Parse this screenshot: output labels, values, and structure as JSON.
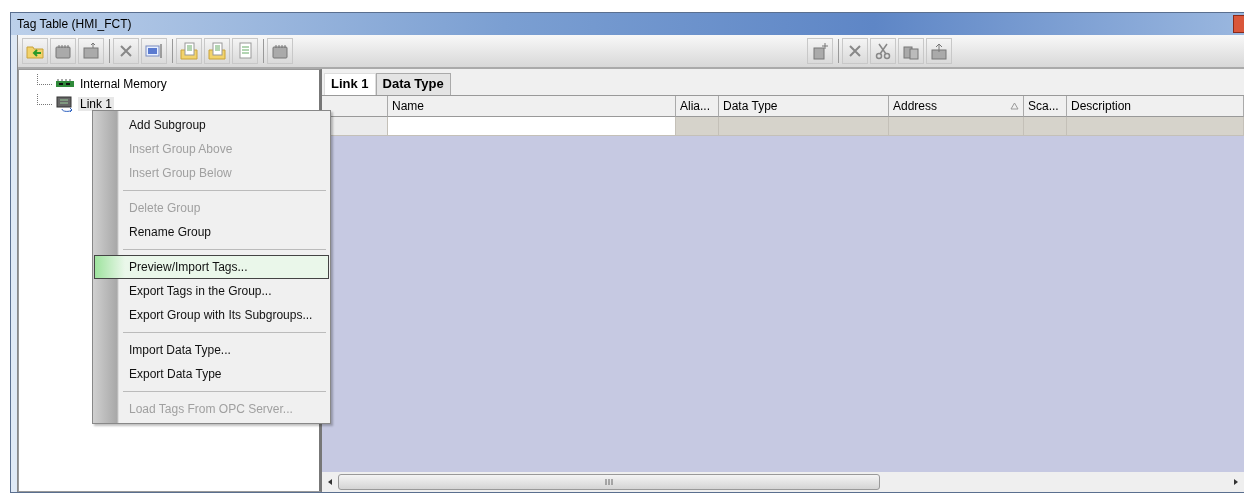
{
  "window": {
    "title": "Tag Table (HMI_FCT)"
  },
  "tree": [
    {
      "label": "Internal Memory",
      "kind": "memory",
      "selected": false
    },
    {
      "label": "Link 1",
      "kind": "link",
      "selected": true
    }
  ],
  "tabs": [
    {
      "label": "Link 1",
      "selected": true
    },
    {
      "label": "Data Type",
      "selected": false
    }
  ],
  "table": {
    "columns": [
      {
        "label": "Name",
        "sorted": false
      },
      {
        "label": "Alia...",
        "sorted": false
      },
      {
        "label": "Data Type",
        "sorted": false
      },
      {
        "label": "Address",
        "sorted": true
      },
      {
        "label": "Sca...",
        "sorted": false
      },
      {
        "label": "Description",
        "sorted": false
      }
    ]
  },
  "context_menu": [
    {
      "kind": "item",
      "label": "Add Subgroup",
      "disabled": false,
      "selected": false
    },
    {
      "kind": "item",
      "label": "Insert Group Above",
      "disabled": true,
      "selected": false
    },
    {
      "kind": "item",
      "label": "Insert Group Below",
      "disabled": true,
      "selected": false
    },
    {
      "kind": "separator"
    },
    {
      "kind": "item",
      "label": "Delete Group",
      "disabled": true,
      "selected": false
    },
    {
      "kind": "item",
      "label": "Rename Group",
      "disabled": false,
      "selected": false
    },
    {
      "kind": "separator"
    },
    {
      "kind": "item",
      "label": "Preview/Import Tags...",
      "disabled": false,
      "selected": true
    },
    {
      "kind": "item",
      "label": "Export Tags in the Group...",
      "disabled": false,
      "selected": false
    },
    {
      "kind": "item",
      "label": "Export Group with Its Subgroups...",
      "disabled": false,
      "selected": false
    },
    {
      "kind": "separator"
    },
    {
      "kind": "item",
      "label": "Import Data Type...",
      "disabled": false,
      "selected": false
    },
    {
      "kind": "item",
      "label": "Export Data Type",
      "disabled": false,
      "selected": false
    },
    {
      "kind": "separator"
    },
    {
      "kind": "item",
      "label": "Load Tags From OPC Server...",
      "disabled": true,
      "selected": false
    }
  ]
}
